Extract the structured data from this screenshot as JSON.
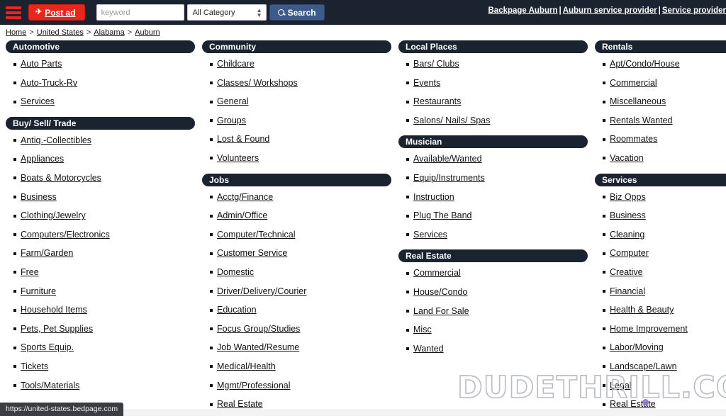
{
  "header": {
    "menu_icon": "hamburger-icon",
    "post_ad_label": "Post ad",
    "post_ad_icon": "paper-plane-icon",
    "search_placeholder": "keyword",
    "search_value": "",
    "category_selected": "All Category",
    "search_button_label": "Search",
    "search_icon": "magnifier-icon",
    "brand_color": "#e8271c",
    "bar_color": "#1c2330",
    "search_button_color": "#3d5a8a",
    "links": [
      {
        "label": "Backpage Auburn"
      },
      {
        "label": "Auburn service provider"
      },
      {
        "label": "Service provider"
      }
    ],
    "link_separator": "|"
  },
  "breadcrumb": {
    "separator": ">",
    "items": [
      {
        "label": "Home"
      },
      {
        "label": "United States"
      },
      {
        "label": "Alabama"
      },
      {
        "label": "Auburn"
      }
    ]
  },
  "columns": [
    {
      "sections": [
        {
          "title": "Automotive",
          "items": [
            "Auto Parts",
            "Auto-Truck-Rv",
            "Services"
          ]
        },
        {
          "title": "Buy/ Sell/ Trade",
          "items": [
            "Antiq.-Collectibles",
            "Appliances",
            "Boats & Motorcycles",
            "Business",
            "Clothing/Jewelry",
            "Computers/Electronics",
            "Farm/Garden",
            "Free",
            "Furniture",
            "Household Items",
            "Pets, Pet Supplies",
            "Sports Equip.",
            "Tickets",
            "Tools/Materials"
          ]
        }
      ]
    },
    {
      "sections": [
        {
          "title": "Community",
          "items": [
            "Childcare",
            "Classes/ Workshops",
            "General",
            "Groups",
            "Lost & Found",
            "Volunteers"
          ]
        },
        {
          "title": "Jobs",
          "items": [
            "Acctg/Finance",
            "Admin/Office",
            "Computer/Technical",
            "Customer Service",
            "Domestic",
            "Driver/Delivery/Courier",
            "Education",
            "Focus Group/Studies",
            "Job Wanted/Resume",
            "Medical/Health",
            "Mgmt/Professional",
            "Real Estate"
          ]
        }
      ]
    },
    {
      "sections": [
        {
          "title": "Local Places",
          "items": [
            "Bars/ Clubs",
            "Events",
            "Restaurants",
            "Salons/ Nails/ Spas"
          ]
        },
        {
          "title": "Musician",
          "items": [
            "Available/Wanted",
            "Equip/Instruments",
            "Instruction",
            "Plug The Band",
            "Services"
          ]
        },
        {
          "title": "Real Estate",
          "items": [
            "Commercial",
            "House/Condo",
            "Land For Sale",
            "Misc",
            "Wanted"
          ]
        }
      ]
    },
    {
      "sections": [
        {
          "title": "Rentals",
          "items": [
            "Apt/Condo/House",
            "Commercial",
            "Miscellaneous",
            "Rentals Wanted",
            "Roommates",
            "Vacation"
          ]
        },
        {
          "title": "Services",
          "items": [
            "Biz Opps",
            "Business",
            "Cleaning",
            "Computer",
            "Creative",
            "Financial",
            "Health & Beauty",
            "Home Improvement",
            "Labor/Moving",
            "Landscape/Lawn",
            "Legal",
            "Real Estate"
          ]
        }
      ]
    }
  ],
  "watermark": {
    "text": "DUDETHRILL.COM"
  },
  "statusbar": {
    "url": "https://united-states.bedpage.com"
  }
}
